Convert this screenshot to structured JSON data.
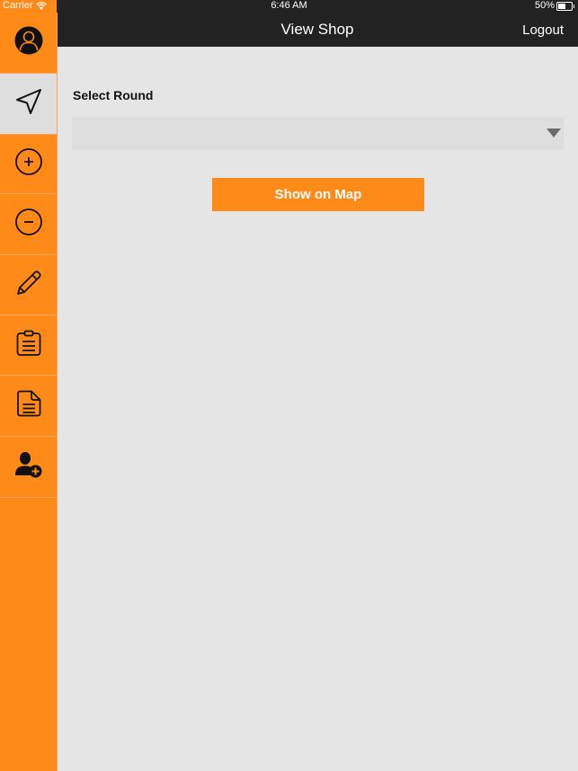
{
  "status_bar": {
    "carrier": "Carrier",
    "time": "6:46 AM",
    "battery": "50%",
    "battery_level": 0.5
  },
  "navbar": {
    "title": "View Shop",
    "logout_label": "Logout"
  },
  "sidebar": {
    "items": [
      {
        "name": "profile",
        "icon": "user-avatar-icon",
        "active": false
      },
      {
        "name": "navigate",
        "icon": "navigation-arrow-icon",
        "active": true
      },
      {
        "name": "add",
        "icon": "plus-circle-icon",
        "active": false
      },
      {
        "name": "remove",
        "icon": "minus-circle-icon",
        "active": false
      },
      {
        "name": "edit",
        "icon": "pencil-icon",
        "active": false
      },
      {
        "name": "clipboard",
        "icon": "clipboard-icon",
        "active": false
      },
      {
        "name": "document",
        "icon": "document-icon",
        "active": false
      },
      {
        "name": "add-user",
        "icon": "add-user-icon",
        "active": false
      }
    ]
  },
  "main": {
    "select_label": "Select Round",
    "select_value": "",
    "show_on_map_label": "Show on Map"
  },
  "colors": {
    "accent": "#ff8a17",
    "navbar": "#222222",
    "background": "#e5e5e5",
    "active_item": "#dedede"
  }
}
